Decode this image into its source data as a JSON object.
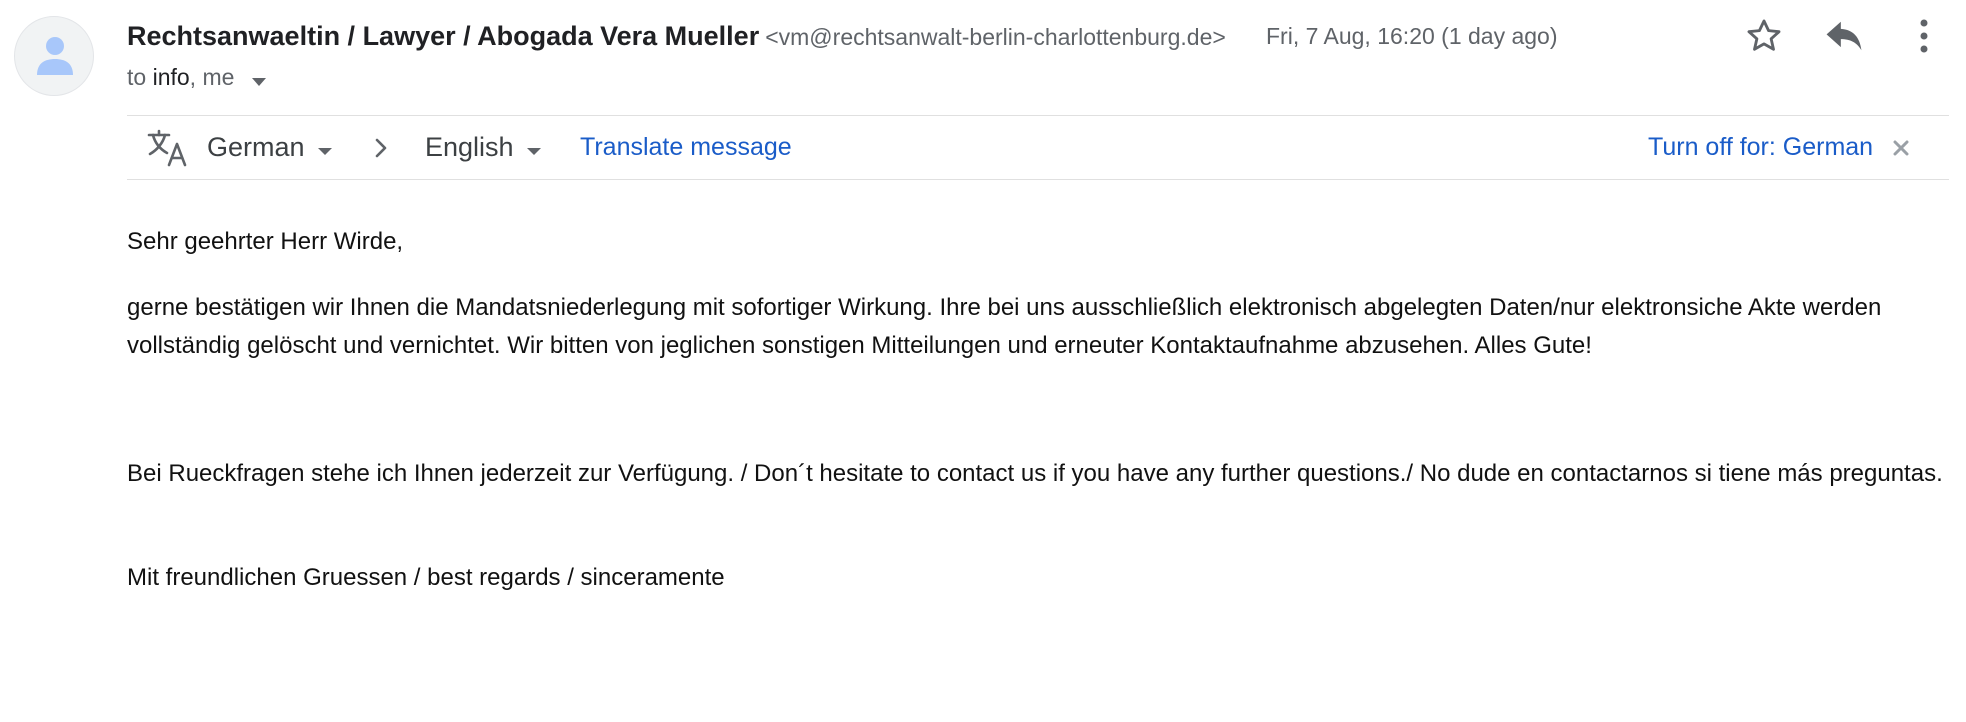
{
  "sender": {
    "name": "Rechtsanwaeltin / Lawyer / Abogada Vera Mueller",
    "email": "<vm@rechtsanwalt-berlin-charlottenburg.de>"
  },
  "recipients": {
    "prefix": "to ",
    "primary": "info",
    "rest": ", me"
  },
  "date": "Fri, 7 Aug, 16:20 (1 day ago)",
  "icons": {
    "avatar": "person-icon",
    "star": "star-icon",
    "reply": "reply-icon",
    "more": "more-vert-icon",
    "translate": "translate-icon",
    "arrow": "chevron-right-icon",
    "close": "close-icon"
  },
  "translate_bar": {
    "source_lang": "German",
    "target_lang": "English",
    "translate_label": "Translate message",
    "turn_off_label": "Turn off for: German"
  },
  "body": {
    "greeting": "Sehr geehrter Herr Wirde,",
    "paragraph_main": "gerne bestätigen wir Ihnen die Mandatsniederlegung mit sofortiger Wirkung. Ihre bei uns ausschließlich elektronisch abgelegten Daten/nur elektronsiche Akte werden vollständig gelöscht und vernichtet. Wir bitten von jeglichen sonstigen Mitteilungen und erneuter Kontaktaufnahme abzusehen. Alles Gute!",
    "paragraph_contact": "Bei Rueckfragen stehe ich Ihnen jederzeit zur Verfügung. / Don´t hesitate to contact us if you have any further questions./ No dude en contactarnos si tiene más preguntas.",
    "regards": "Mit freundlichen Gruessen / best regards / sinceramente"
  },
  "colors": {
    "link": "#1a5cc8",
    "secondary_text": "#5f6368",
    "avatar_bg": "#f1f3f4",
    "avatar_icon": "#a8c7fa"
  }
}
